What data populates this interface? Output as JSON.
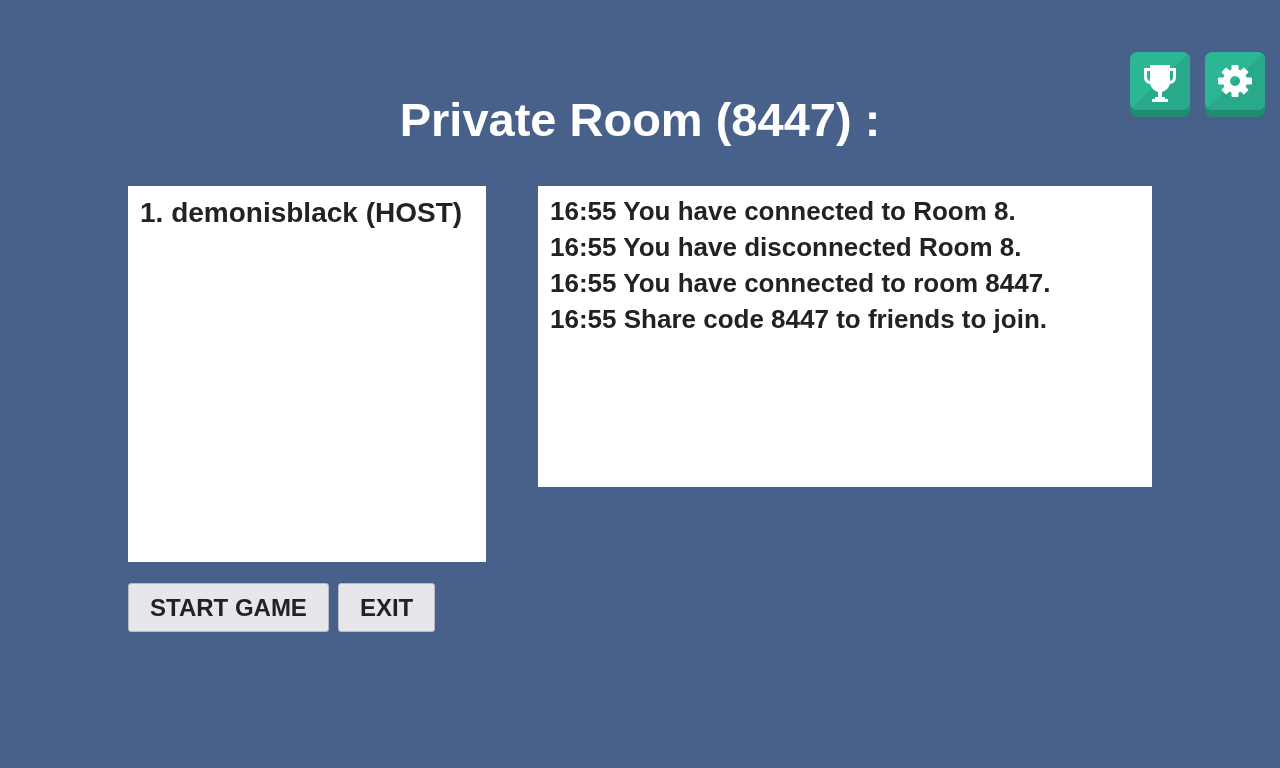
{
  "title": "Private Room (8447) :",
  "players": [
    "1. demonisblack (HOST)"
  ],
  "log": [
    "16:55 You have connected to Room 8.",
    "16:55 You have disconnected Room 8.",
    "16:55 You have connected to room 8447.",
    "16:55 Share code 8447 to friends to join."
  ],
  "buttons": [
    "START GAME",
    "EXIT"
  ]
}
